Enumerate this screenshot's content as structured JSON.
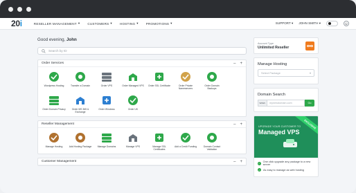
{
  "nav": {
    "logo_main": "20",
    "logo_accent": "i",
    "menu": [
      {
        "label": "RESELLER MANAGEMENT",
        "caret": "▾"
      },
      {
        "label": "CUSTOMERS",
        "caret": "▾"
      },
      {
        "label": "HOSTING",
        "caret": "▾"
      },
      {
        "label": "PROMOTIONS",
        "caret": "▾"
      }
    ],
    "support": "SUPPORT ▾",
    "user": "JOHN SMITH ▾"
  },
  "greeting": {
    "prefix": "Good evening, ",
    "name": "John"
  },
  "search": {
    "placeholder": "Search by ID"
  },
  "order_services": {
    "title": "Order Services",
    "minus": "–",
    "plus": "+",
    "items": [
      {
        "label": "Wordpress Hosting",
        "color": "#2ea84a"
      },
      {
        "label": "Transfer a Domain",
        "color": "#2ea84a"
      },
      {
        "label": "Order VPS",
        "color": "#6a737c"
      },
      {
        "label": "Order Managed VPS",
        "color": "#2ea84a"
      },
      {
        "label": "Order SSL Certificate",
        "color": "#2ea84a"
      },
      {
        "label": "Order Private Nameservers",
        "color": "#d1a24a"
      },
      {
        "label": "Order Domain Backups",
        "color": "#2ea84a"
      },
      {
        "label": "Order Domain Privacy",
        "color": "#2ea84a"
      },
      {
        "label": "Order MS 365 & Exchange",
        "color": "#2d7fd1"
      },
      {
        "label": "Order Windows",
        "color": "#2d7fd1"
      },
      {
        "label": "Order UK",
        "color": "#2ea84a"
      }
    ]
  },
  "reseller_management": {
    "title": "Reseller Management",
    "minus": "–",
    "plus": "+",
    "items": [
      {
        "label": "Manage Hosting",
        "color": "#b0712f"
      },
      {
        "label": "Add Hosting Package",
        "color": "#b0712f"
      },
      {
        "label": "Manage Domains",
        "color": "#2ea84a"
      },
      {
        "label": "Manage VPS",
        "color": "#6a737c"
      },
      {
        "label": "Manage SSL Certificates",
        "color": "#2ea84a"
      },
      {
        "label": "Add a Credit Funding",
        "color": "#2ea84a"
      },
      {
        "label": "Domain Contact Validation",
        "color": "#2ea84a"
      }
    ]
  },
  "customer_management": {
    "title": "Customer Management",
    "minus": "–",
    "plus": "+"
  },
  "side": {
    "account_type_label": "Account Type",
    "account_type_value": "Unlimited Reseller",
    "manage_hosting_title": "Manage Hosting",
    "select_placeholder": "Select Package",
    "domain_search_title": "Domain Search",
    "domain_prefix": "www.",
    "domain_placeholder": "mynewdomain.com",
    "domain_button": "Go"
  },
  "promo": {
    "upgrade_text": "UPGRADE YOUR CUSTOMER TO",
    "product": "Managed VPS",
    "ribbon": "EXCLUSIVE",
    "bullets": [
      "One click upgrade any package to a new server",
      "As easy to manage as web hosting"
    ]
  }
}
